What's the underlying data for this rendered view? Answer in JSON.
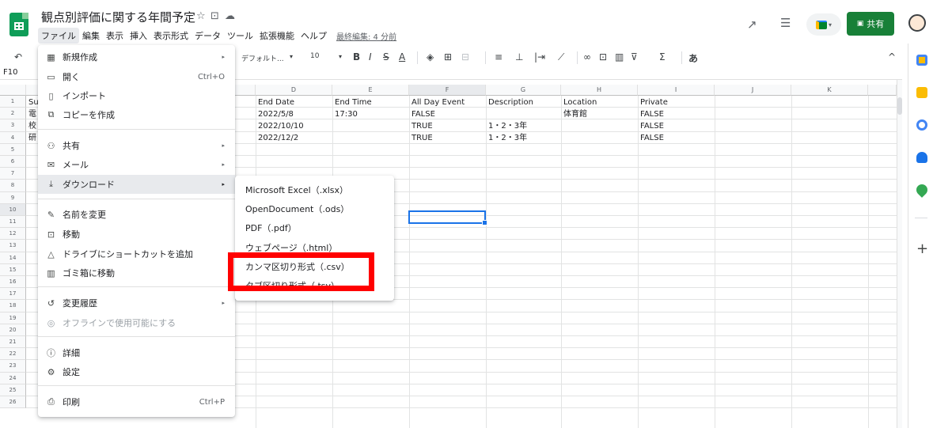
{
  "app": {
    "doc_title": "観点別評価に関する年間予定",
    "menubar": [
      {
        "label": "ファイル"
      },
      {
        "label": "編集"
      },
      {
        "label": "表示"
      },
      {
        "label": "挿入"
      },
      {
        "label": "表示形式"
      },
      {
        "label": "データ"
      },
      {
        "label": "ツール"
      },
      {
        "label": "拡張機能"
      },
      {
        "label": "ヘルプ"
      }
    ],
    "last_edit": "最終編集: 4 分前",
    "share_label": "共有",
    "accent_color": "#188038"
  },
  "toolbar": {
    "font": "デフォルト...",
    "font_size": "10",
    "input_mode": "あ"
  },
  "namebox": "F10",
  "grid": {
    "columns": [
      {
        "label": "D"
      },
      {
        "label": "E"
      },
      {
        "label": "F"
      },
      {
        "label": "G"
      },
      {
        "label": "H"
      },
      {
        "label": "I"
      },
      {
        "label": "J"
      },
      {
        "label": "K"
      }
    ],
    "rows": [
      "1",
      "2",
      "3",
      "4",
      "5",
      "6",
      "7",
      "8",
      "9",
      "10",
      "11",
      "12",
      "13",
      "14",
      "15",
      "16",
      "17",
      "18",
      "19",
      "20",
      "21",
      "22",
      "23",
      "24",
      "25",
      "26"
    ],
    "col_a_fragments": [
      "Su",
      "電",
      "校",
      "研"
    ],
    "cells": [
      [
        "End Date",
        "End Time",
        "All Day Event",
        "Description",
        "Location",
        "Private"
      ],
      [
        "2022/5/8",
        "17:30",
        "FALSE",
        "",
        "体育館",
        "FALSE"
      ],
      [
        "2022/10/10",
        "",
        "TRUE",
        "1・2・3年",
        "",
        "FALSE"
      ],
      [
        "2022/12/2",
        "",
        "TRUE",
        "1・2・3年",
        "",
        "FALSE"
      ]
    ]
  },
  "file_menu": {
    "items": [
      {
        "label": "新規作成",
        "icon": "new-doc-icon"
      },
      {
        "label": "開く",
        "shortcut": "Ctrl+O",
        "icon": "folder-icon"
      },
      {
        "label": "インポート",
        "icon": "import-icon"
      },
      {
        "label": "コピーを作成",
        "icon": "copy-icon"
      },
      {
        "label": "共有",
        "icon": "person-add-icon"
      },
      {
        "label": "メール",
        "icon": "mail-icon"
      },
      {
        "label": "ダウンロード",
        "icon": "download-icon"
      },
      {
        "label": "名前を変更",
        "icon": "rename-icon"
      },
      {
        "label": "移動",
        "icon": "move-icon"
      },
      {
        "label": "ドライブにショートカットを追加",
        "icon": "drive-shortcut-icon"
      },
      {
        "label": "ゴミ箱に移動",
        "icon": "trash-icon"
      },
      {
        "label": "変更履歴",
        "icon": "history-icon"
      },
      {
        "label": "オフラインで使用可能にする",
        "icon": "offline-icon"
      },
      {
        "label": "詳細",
        "icon": "info-icon"
      },
      {
        "label": "設定",
        "icon": "settings-icon"
      },
      {
        "label": "印刷",
        "shortcut": "Ctrl+P",
        "icon": "print-icon"
      }
    ]
  },
  "download_menu": {
    "items": [
      {
        "label": "Microsoft Excel（.xlsx）"
      },
      {
        "label": "OpenDocument（.ods）"
      },
      {
        "label": "PDF（.pdf）"
      },
      {
        "label": "ウェブページ（.html）"
      },
      {
        "label": "カンマ区切り形式（.csv）"
      },
      {
        "label": "タブ区切り形式（.tsv）"
      }
    ]
  },
  "highlight_color": "#ff0000"
}
